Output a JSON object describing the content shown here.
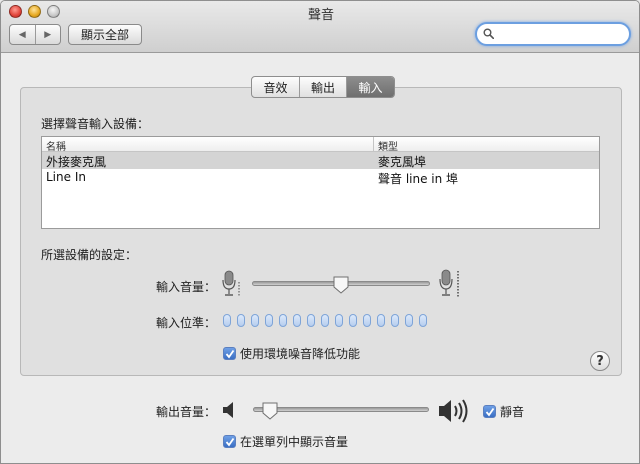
{
  "window": {
    "title": "聲音"
  },
  "toolbar": {
    "back_glyph": "◀",
    "forward_glyph": "▶",
    "show_all_label": "顯示全部",
    "search_placeholder": "",
    "search_value": ""
  },
  "tabs": [
    {
      "label": "音效",
      "active": false
    },
    {
      "label": "輸出",
      "active": false
    },
    {
      "label": "輸入",
      "active": true
    }
  ],
  "input_devices": {
    "section_title": "選擇聲音輸入設備：",
    "columns": [
      "名稱",
      "類型"
    ],
    "rows": [
      {
        "name": "外接麥克風",
        "type": "麥克風埠",
        "selected": true
      },
      {
        "name": "Line In",
        "type": "聲音 line in 埠",
        "selected": false
      }
    ]
  },
  "device_settings": {
    "section_title": "所選設備的設定：",
    "input_volume_label": "輸入音量：",
    "input_volume_level": 0.5,
    "input_level_label": "輸入位準：",
    "input_level_segments": 15,
    "noise_reduction_label": "使用環境噪音降低功能",
    "noise_reduction_checked": true
  },
  "help_label": "?",
  "output": {
    "volume_label": "輸出音量：",
    "volume_level": 0.05,
    "mute_label": "靜音",
    "mute_checked": true,
    "show_in_menu_label": "在選單列中顯示音量",
    "show_in_menu_checked": true
  },
  "colors": {
    "selected_tab": "#7a7a7a",
    "checkbox": "#3a6fc4",
    "meter": "#b6cdee",
    "search_focus": "#6c9fe0"
  }
}
